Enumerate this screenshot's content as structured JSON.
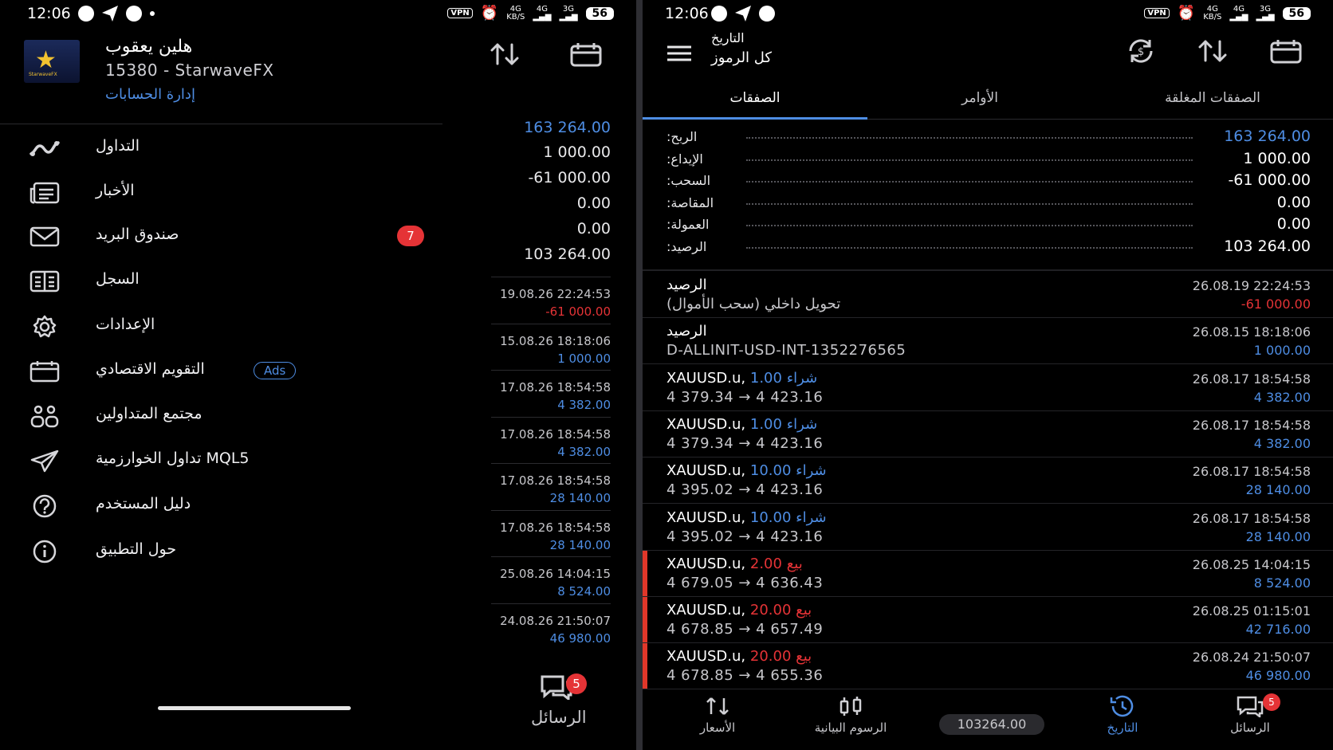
{
  "left": {
    "status": {
      "time": "12:06",
      "battery": "56",
      "vpn": "VPN",
      "net": "4G",
      "net_unit": "KB/S",
      "sig1": "4G",
      "sig2": "3G"
    },
    "account": {
      "name": "هلين يعقوب",
      "sub": "15380 - StarwaveFX",
      "manage": "إدارة الحسابات",
      "logo_text": "StarwaveFX"
    },
    "menu": [
      {
        "label": "التداول",
        "icon": "trade-chart-icon"
      },
      {
        "label": "الأخبار",
        "icon": "news-icon"
      },
      {
        "label": "صندوق البريد",
        "icon": "mail-icon",
        "badge": "7"
      },
      {
        "label": "السجل",
        "icon": "journal-icon"
      },
      {
        "label": "الإعدادات",
        "icon": "gear-icon"
      },
      {
        "label": "التقويم الاقتصادي",
        "icon": "calendar-icon",
        "tag": "Ads"
      },
      {
        "label": "مجتمع المتداولين",
        "icon": "community-icon"
      },
      {
        "label": "تداول الخوارزمية MQL5",
        "icon": "send-icon"
      },
      {
        "label": "دليل المستخدم",
        "icon": "help-icon"
      },
      {
        "label": "حول التطبيق",
        "icon": "info-icon"
      }
    ],
    "summary_values": [
      "163 264.00",
      "1 000.00",
      "-61 000.00",
      "0.00",
      "0.00",
      "103 264.00"
    ],
    "rows": [
      {
        "date": "19.08.26 22:24:53",
        "value": "-61 000.00",
        "neg": true
      },
      {
        "date": "15.08.26 18:18:06",
        "value": "1 000.00"
      },
      {
        "date": "17.08.26 18:54:58",
        "value": "4 382.00"
      },
      {
        "date": "17.08.26 18:54:58",
        "value": "4 382.00"
      },
      {
        "date": "17.08.26 18:54:58",
        "value": "28 140.00"
      },
      {
        "date": "17.08.26 18:54:58",
        "value": "28 140.00"
      },
      {
        "date": "25.08.26 14:04:15",
        "value": "8 524.00"
      },
      {
        "date": "24.08.26 21:50:07",
        "value": "46 980.00"
      }
    ],
    "messages": {
      "label": "الرسائل",
      "badge": "5"
    }
  },
  "right": {
    "status": {
      "time": "12:06",
      "battery": "56",
      "vpn": "VPN",
      "net": "4G",
      "net_unit": "KB/S",
      "sig1": "4G",
      "sig2": "3G"
    },
    "header": {
      "title": "التاريخ",
      "subtitle": "كل الرموز"
    },
    "tabs": [
      {
        "label": "الصفقات",
        "active": true
      },
      {
        "label": "الأوامر"
      },
      {
        "label": "الصفقات المغلقة"
      }
    ],
    "summary": [
      {
        "label": ":الربح",
        "value": "163 264.00",
        "pos": true
      },
      {
        "label": ":الإيداع",
        "value": "1 000.00"
      },
      {
        "label": ":السحب",
        "value": "-61 000.00"
      },
      {
        "label": ":المقاصة",
        "value": "0.00"
      },
      {
        "label": ":العمولة",
        "value": "0.00"
      },
      {
        "label": ":الرصيد",
        "value": "103 264.00"
      }
    ],
    "deals": [
      {
        "title": "الرصيد",
        "sub": "تحويل داخلي (سحب الأموال)",
        "date": "26.08.19 22:24:53",
        "value": "-61 000.00",
        "neg": true
      },
      {
        "title": "الرصيد",
        "sub": "D-ALLINIT-USD-INT-1352276565",
        "date": "26.08.15 18:18:06",
        "value": "1 000.00"
      },
      {
        "symbol": "XAUUSD.u,",
        "type": "شراء",
        "lots": "1.00",
        "side": "buy",
        "sub": "4 379.34 → 4 423.16",
        "date": "26.08.17 18:54:58",
        "value": "4 382.00"
      },
      {
        "symbol": "XAUUSD.u,",
        "type": "شراء",
        "lots": "1.00",
        "side": "buy",
        "sub": "4 379.34 → 4 423.16",
        "date": "26.08.17 18:54:58",
        "value": "4 382.00"
      },
      {
        "symbol": "XAUUSD.u,",
        "type": "شراء",
        "lots": "10.00",
        "side": "buy",
        "sub": "4 395.02 → 4 423.16",
        "date": "26.08.17 18:54:58",
        "value": "28 140.00"
      },
      {
        "symbol": "XAUUSD.u,",
        "type": "شراء",
        "lots": "10.00",
        "side": "buy",
        "sub": "4 395.02 → 4 423.16",
        "date": "26.08.17 18:54:58",
        "value": "28 140.00"
      },
      {
        "symbol": "XAUUSD.u,",
        "type": "بيع",
        "lots": "2.00",
        "side": "sell",
        "sub": "4 679.05 → 4 636.43",
        "date": "26.08.25 14:04:15",
        "value": "8 524.00"
      },
      {
        "symbol": "XAUUSD.u,",
        "type": "بيع",
        "lots": "20.00",
        "side": "sell",
        "sub": "4 678.85 → 4 657.49",
        "date": "26.08.25 01:15:01",
        "value": "42 716.00"
      },
      {
        "symbol": "XAUUSD.u,",
        "type": "بيع",
        "lots": "20.00",
        "side": "sell",
        "sub": "4 678.85 → 4 655.36",
        "date": "26.08.24 21:50:07",
        "value": "46 980.00"
      }
    ],
    "nav": {
      "quotes": "الأسعار",
      "charts": "الرسوم البيانية",
      "balance": "103264.00",
      "history": "التاريخ",
      "messages": "الرسائل",
      "messages_badge": "5"
    }
  },
  "colors": {
    "accent": "#4e8de3",
    "negative": "#e53336",
    "sell_bar": "#e0372a",
    "background": "#000000"
  }
}
